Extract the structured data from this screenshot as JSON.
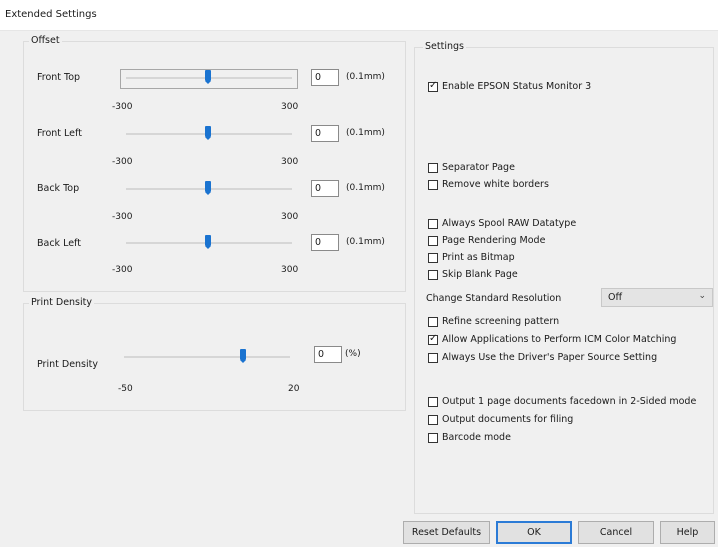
{
  "window": {
    "title": "Extended Settings"
  },
  "offset": {
    "group_title": "Offset",
    "unit": "(0.1mm)",
    "sliders": [
      {
        "label": "Front Top",
        "value": "0",
        "min": "-300",
        "max": "300",
        "level": 0.5
      },
      {
        "label": "Front Left",
        "value": "0",
        "min": "-300",
        "max": "300",
        "level": 0.5
      },
      {
        "label": "Back Top",
        "value": "0",
        "min": "-300",
        "max": "300",
        "level": 0.5
      },
      {
        "label": "Back Left",
        "value": "0",
        "min": "-300",
        "max": "300",
        "level": 0.5
      }
    ]
  },
  "print_density": {
    "group_title": "Print Density",
    "label": "Print Density",
    "value": "0",
    "unit": "(%)",
    "min": "-50",
    "max": "20",
    "level": 0.714
  },
  "settings": {
    "group_title": "Settings",
    "enable_status_monitor": {
      "label": "Enable EPSON Status Monitor 3",
      "checked": true
    },
    "separator_page": {
      "label": "Separator Page",
      "checked": false
    },
    "remove_white_borders": {
      "label": "Remove white borders",
      "checked": false
    },
    "always_spool_raw": {
      "label": "Always Spool RAW Datatype",
      "checked": false
    },
    "page_rendering_mode": {
      "label": "Page Rendering Mode",
      "checked": false
    },
    "print_as_bitmap": {
      "label": "Print as Bitmap",
      "checked": false
    },
    "skip_blank_page": {
      "label": "Skip Blank Page",
      "checked": false
    },
    "change_standard_resolution": {
      "label": "Change Standard Resolution",
      "value": "Off"
    },
    "refine_screening": {
      "label": "Refine screening pattern",
      "checked": false
    },
    "allow_icm": {
      "label": "Allow Applications to Perform ICM Color Matching",
      "checked": true
    },
    "always_driver_paper_source": {
      "label": "Always Use the Driver's Paper Source Setting",
      "checked": false
    },
    "output_facedown": {
      "label": "Output 1 page documents facedown in 2-Sided mode",
      "checked": false
    },
    "output_filing": {
      "label": "Output documents for filing",
      "checked": false
    },
    "barcode_mode": {
      "label": "Barcode mode",
      "checked": false
    }
  },
  "buttons": {
    "reset_defaults": "Reset Defaults",
    "ok": "OK",
    "cancel": "Cancel",
    "help": "Help"
  },
  "icons": {
    "dropdown": "chevron-down-icon",
    "check": "checkmark-icon"
  },
  "colors": {
    "slider_thumb": "#1a73d0",
    "ok_border": "#2b7bd6"
  }
}
